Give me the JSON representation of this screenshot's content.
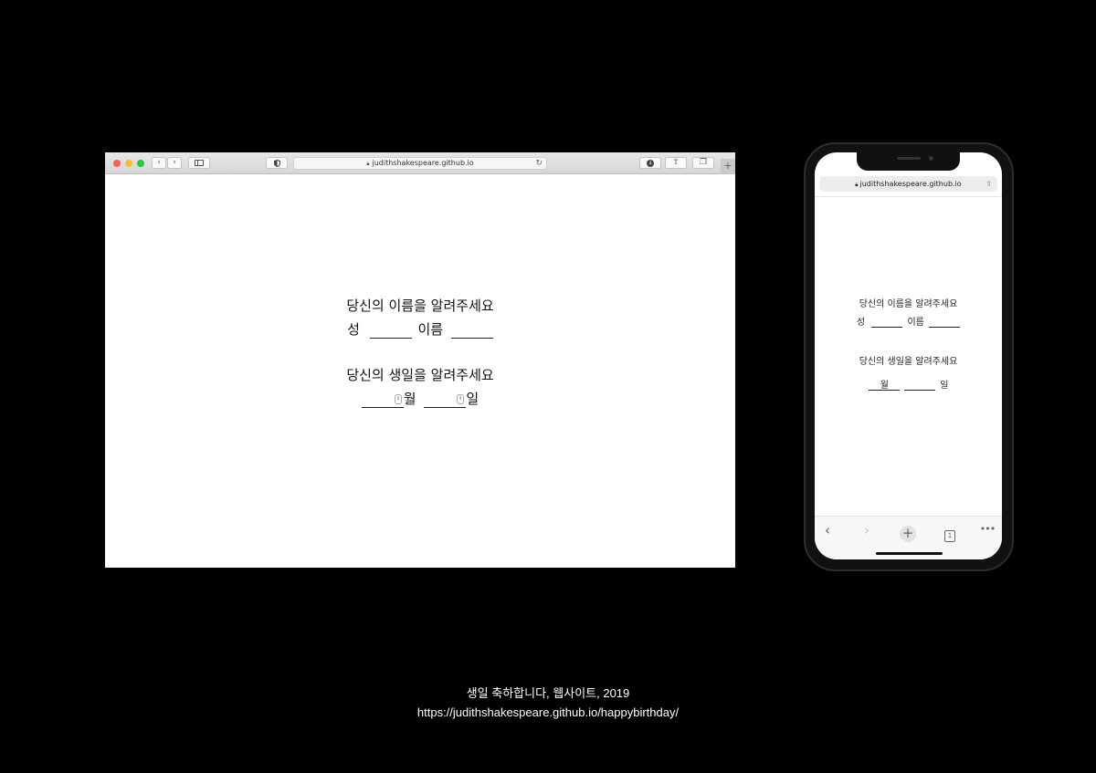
{
  "desktop": {
    "url": "judithshakespeare.github.io",
    "nav_back_icon": "chevron-left-icon",
    "nav_forward_icon": "chevron-right-icon",
    "new_tab_label": "+",
    "name_prompt": "당신의 이름을 알려주세요",
    "last_name_label": "성",
    "first_name_label": "이름",
    "birthday_prompt": "당신의 생일을 알려주세요",
    "month_label": "월",
    "day_label": "일"
  },
  "mobile": {
    "url": "judithshakespeare.github.io",
    "name_prompt": "당신의 이름을 알려주세요",
    "last_name_label": "성",
    "first_name_label": "이름",
    "birthday_prompt": "당신의 생일을 알려주세요",
    "month_label": "월",
    "day_label": "일",
    "tab_count": "1"
  },
  "caption": {
    "line1": "생일 축하합니다, 웹사이트, 2019",
    "line2": "https://judithshakespeare.github.io/happybirthday/"
  }
}
